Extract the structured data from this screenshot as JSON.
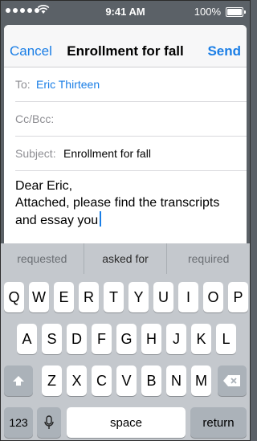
{
  "status_bar": {
    "time": "9:41 AM",
    "battery": "100%"
  },
  "compose": {
    "cancel": "Cancel",
    "title": "Enrollment for fall",
    "send": "Send",
    "to_label": "To:",
    "to_value": "Eric Thirteen",
    "cc_label": "Cc/Bcc:",
    "subject_label": "Subject:",
    "subject_value": "Enrollment for fall",
    "body_lines": [
      "Dear Eric,",
      "Attached, please find the transcripts",
      "and essay you"
    ]
  },
  "suggestions": [
    "requested",
    "asked for",
    "required"
  ],
  "keyboard": {
    "row1": [
      "Q",
      "W",
      "E",
      "R",
      "T",
      "Y",
      "U",
      "I",
      "O",
      "P"
    ],
    "row2": [
      "A",
      "S",
      "D",
      "F",
      "G",
      "H",
      "J",
      "K",
      "L"
    ],
    "row3": [
      "Z",
      "X",
      "C",
      "V",
      "B",
      "N",
      "M"
    ],
    "numbers": "123",
    "space": "space",
    "return": "return"
  },
  "colors": {
    "accent": "#1a7ee6"
  }
}
